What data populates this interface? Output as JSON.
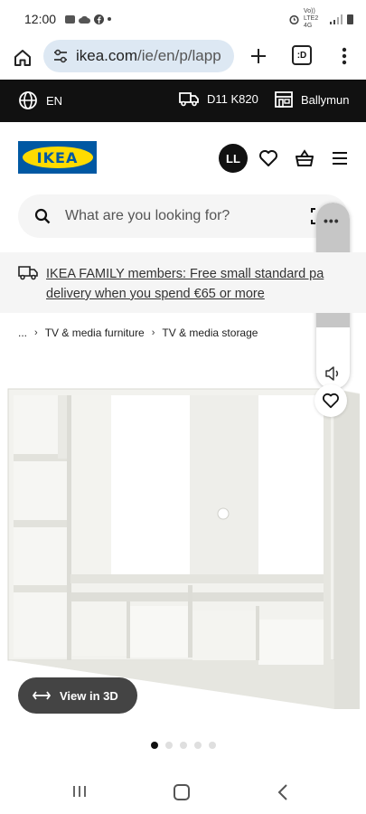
{
  "status_bar": {
    "time": "12:00",
    "network": "Vo)) LTE2 4G",
    "icons": [
      "notification-icon",
      "cloud-icon",
      "facebook-icon",
      "alarm-icon",
      "signal-icon",
      "battery-icon"
    ]
  },
  "browser": {
    "url_host": "ikea.com",
    "url_path": "/ie/en/p/lapp",
    "tabs_label": ":D"
  },
  "top_bar": {
    "language": "EN",
    "postcode": "D11 K820",
    "store": "Ballymun"
  },
  "header": {
    "logo_text": "IKEA",
    "avatar_initials": "LL"
  },
  "search": {
    "placeholder": "What are you looking for?"
  },
  "banner": {
    "line1": "IKEA FAMILY members: Free small standard pa",
    "line2": "delivery when you spend €65 or more"
  },
  "breadcrumb": {
    "ellipsis": "...",
    "items": [
      "TV & media furniture",
      "TV & media storage"
    ]
  },
  "product": {
    "view3d_label": "View in 3D",
    "image_count": 5,
    "active_image": 1
  },
  "colors": {
    "ikea_blue": "#0058a3",
    "ikea_yellow": "#ffdb00",
    "top_bar_bg": "#111111",
    "url_pill_bg": "#dde8f3"
  }
}
